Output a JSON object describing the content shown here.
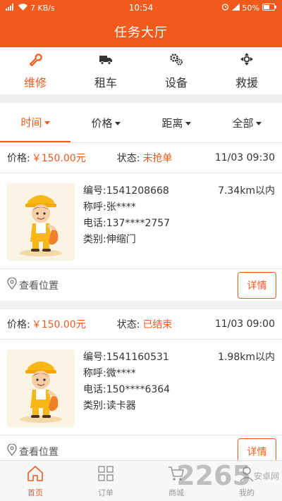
{
  "status_bar": {
    "network": "7 KB/s",
    "time": "10:54",
    "battery": "50%"
  },
  "header": {
    "title": "任务大厅"
  },
  "categories": [
    {
      "label": "维修",
      "icon": "wrench-icon",
      "active": true
    },
    {
      "label": "租车",
      "icon": "truck-icon",
      "active": false
    },
    {
      "label": "设备",
      "icon": "gears-icon",
      "active": false
    },
    {
      "label": "救援",
      "icon": "crosshair-icon",
      "active": false
    }
  ],
  "filters": [
    {
      "label": "时间",
      "active": true
    },
    {
      "label": "价格",
      "active": false
    },
    {
      "label": "距离",
      "active": false
    },
    {
      "label": "全部",
      "active": false
    }
  ],
  "orders": [
    {
      "price_label": "价格:",
      "price": "￥150.00元",
      "status_label": "状态:",
      "status": "未抢单",
      "time": "11/03 09:30",
      "number_label": "编号:",
      "number": "1541208668",
      "distance": "7.34km以内",
      "name_label": "称呼:",
      "name": "张****",
      "phone_label": "电话:",
      "phone": "137****2757",
      "type_label": "类别:",
      "type": "伸缩门",
      "location": "查看位置",
      "detail_button": "详情"
    },
    {
      "price_label": "价格:",
      "price": "￥150.00元",
      "status_label": "状态:",
      "status": "已结束",
      "time": "11/03 09:00",
      "number_label": "编号:",
      "number": "1541160531",
      "distance": "1.98km以内",
      "name_label": "称呼:",
      "name": "微****",
      "phone_label": "电话:",
      "phone": "150****6364",
      "type_label": "类别:",
      "type": "读卡器",
      "location": "查看位置",
      "detail_button": "详情"
    }
  ],
  "tabbar": [
    {
      "label": "首页",
      "icon": "home-icon",
      "active": true
    },
    {
      "label": "订单",
      "icon": "grid-icon",
      "active": false
    },
    {
      "label": "商城",
      "icon": "cart-icon",
      "active": false
    },
    {
      "label": "我的",
      "icon": "user-icon",
      "active": false
    }
  ],
  "watermark": {
    "text": "2265",
    "sub": "安卓网"
  },
  "colors": {
    "accent": "#f25a1d",
    "background": "#f0f0f0"
  }
}
